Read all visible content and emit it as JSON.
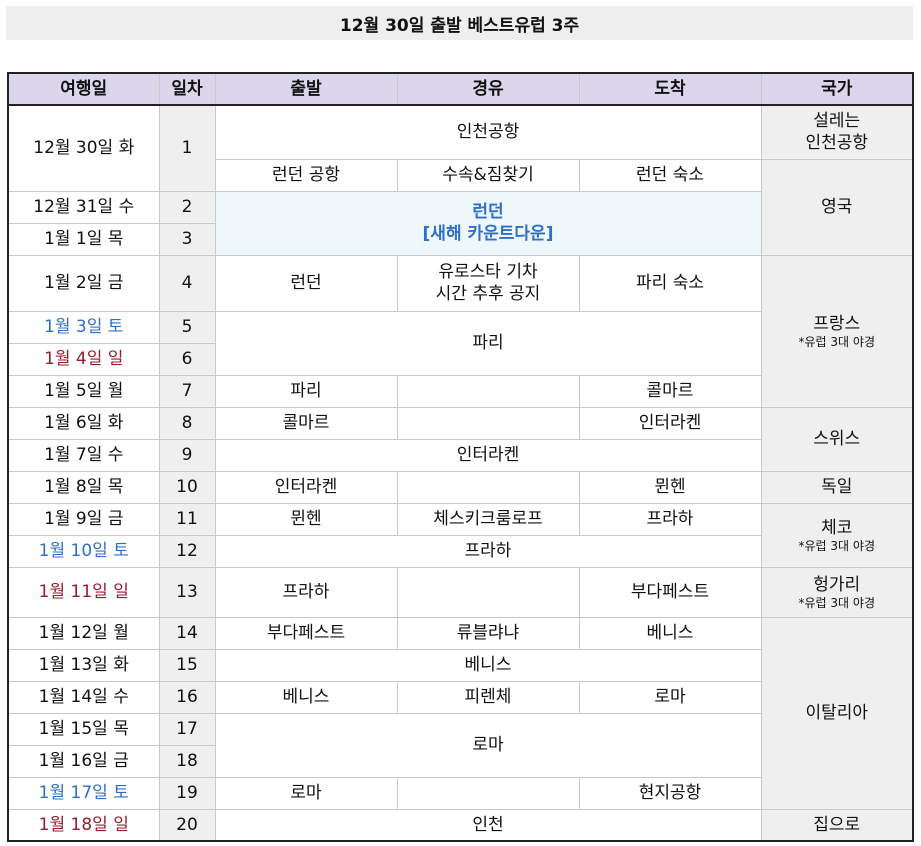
{
  "title": "12월 30일 출발 베스트유럽 3주",
  "headers": [
    "여행일",
    "일차",
    "출발",
    "경유",
    "도착",
    "국가"
  ],
  "dates": [
    "12월 30일 화",
    "12월 31일 수",
    "1월 1일 목",
    "1월 2일 금",
    "1월 3일 토",
    "1월 4일 일",
    "1월 5일 월",
    "1월 6일 화",
    "1월 7일 수",
    "1월 8일 목",
    "1월 9일 금",
    "1월 10일 토",
    "1월 11일 일",
    "1월 12일 월",
    "1월 13일 화",
    "1월 14일 수",
    "1월 15일 목",
    "1월 16일 금",
    "1월 17일 토",
    "1월 18일 일"
  ],
  "days": [
    "1",
    "2",
    "3",
    "4",
    "5",
    "6",
    "7",
    "8",
    "9",
    "10",
    "11",
    "12",
    "13",
    "14",
    "15",
    "16",
    "17",
    "18",
    "19",
    "20"
  ],
  "cells": {
    "r1_span": "인천공항",
    "r1b_from": "런던 공항",
    "r1b_via": "수속&짐찾기",
    "r1b_to": "런던 숙소",
    "r2_line1": "런던",
    "r2_line2": "[새해 카운트다운]",
    "r4_from": "런던",
    "r4_via_line1": "유로스타 기차",
    "r4_via_line2": "시간 추후 공지",
    "r4_to": "파리 숙소",
    "r5_span": "파리",
    "r7_from": "파리",
    "r7_to": "콜마르",
    "r8_from": "콜마르",
    "r8_to": "인터라켄",
    "r9_span": "인터라켄",
    "r10_from": "인터라켄",
    "r10_to": "뮌헨",
    "r11_from": "뮌헨",
    "r11_via": "체스키크룸로프",
    "r11_to": "프라하",
    "r12_span": "프라하",
    "r13_from": "프라하",
    "r13_to": "부다페스트",
    "r14_from": "부다페스트",
    "r14_via": "류블랴냐",
    "r14_to": "베니스",
    "r15_span": "베니스",
    "r16_from": "베니스",
    "r16_via": "피렌체",
    "r16_to": "로마",
    "r17_span": "로마",
    "r19_from": "로마",
    "r19_to": "현지공항",
    "r20_span": "인천"
  },
  "countries": {
    "c1_line1": "설레는",
    "c1_line2": "인천공항",
    "uk": "영국",
    "fr": "프랑스",
    "fr_note": "*유럽 3대 야경",
    "ch": "스위스",
    "de": "독일",
    "cz": "체코",
    "cz_note": "*유럽 3대 야경",
    "hu": "헝가리",
    "hu_note": "*유럽 3대 야경",
    "it": "이탈리아",
    "home": "집으로"
  },
  "colors": {
    "header_bg": "#dcd6ec",
    "saturday": "#2f6fc9",
    "sunday": "#9b1b2e",
    "highlight_bg": "#eef8fb"
  }
}
